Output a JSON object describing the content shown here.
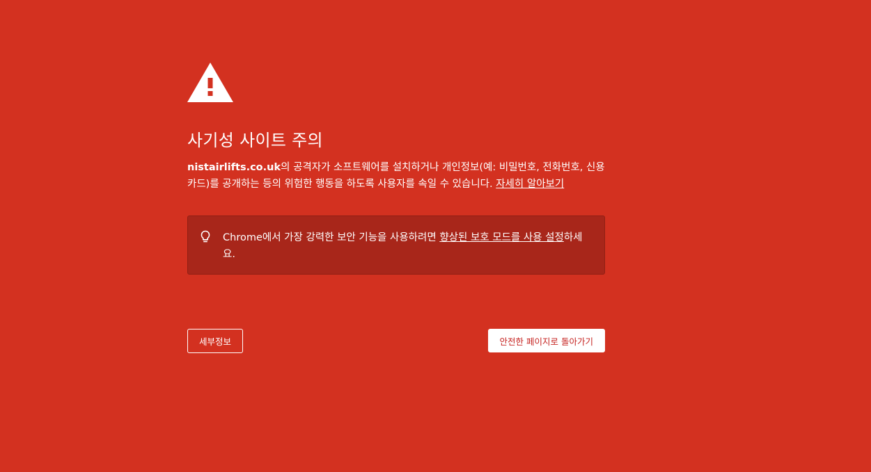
{
  "colors": {
    "background": "#d33120",
    "info_box": "#a8261a",
    "text": "#ffffff",
    "back_button_text": "#c5221f"
  },
  "icons": {
    "warning": "warning-triangle-icon",
    "tip": "lightbulb-icon"
  },
  "interstitial": {
    "heading": "사기성 사이트 주의",
    "domain": "nistairlifts.co.uk",
    "explanation_text": "의 공격자가 소프트웨어를 설치하거나 개인정보(예: 비밀번호, 전화번호, 신용카드)를 공개하는 등의 위험한 행동을 하도록 사용자를 속일 수 있습니다. ",
    "learn_more_link": "자세히 알아보기"
  },
  "enhanced_protection": {
    "prefix": "Chrome에서 가장 강력한 보안 기능을 사용하려면 ",
    "link": "향상된 보호 모드를 사용 설정",
    "suffix": "하세요."
  },
  "buttons": {
    "details_label": "세부정보",
    "back_label": "안전한 페이지로 돌아가기"
  }
}
